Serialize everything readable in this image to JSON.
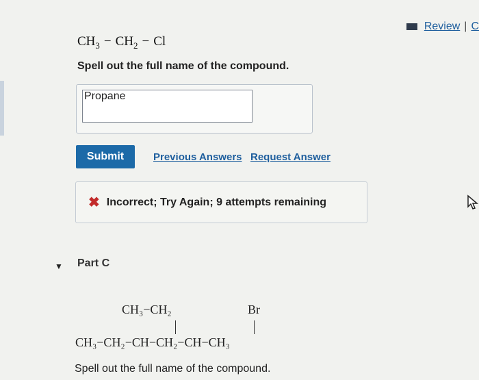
{
  "header": {
    "review_link": "Review",
    "separator": "|",
    "next_link_partial": "C"
  },
  "part_b": {
    "formula": {
      "segments": [
        {
          "main": "CH",
          "sub": "3"
        },
        {
          "main": "−",
          "sub": ""
        },
        {
          "main": "CH",
          "sub": "2"
        },
        {
          "main": "−",
          "sub": ""
        },
        {
          "main": "Cl",
          "sub": ""
        }
      ]
    },
    "prompt": "Spell out the full name of the compound.",
    "answer_value": "Propane",
    "submit_label": "Submit",
    "previous_answers_label": "Previous Answers",
    "request_answer_label": "Request Answer",
    "feedback": {
      "icon": "x-icon",
      "message": "Incorrect; Try Again; 9 attempts remaining",
      "color": "#c22b2b"
    }
  },
  "part_c": {
    "label": "Part C",
    "structure": {
      "top_left": "CH₃−CH₂",
      "top_right": "Br",
      "main_chain": "CH₃−CH₂−CH−CH₂−CH−CH₃"
    },
    "prompt": "Spell out the full name of the compound."
  },
  "colors": {
    "accent": "#1c6aa8",
    "link": "#1f5f9e",
    "error": "#c22b2b"
  }
}
